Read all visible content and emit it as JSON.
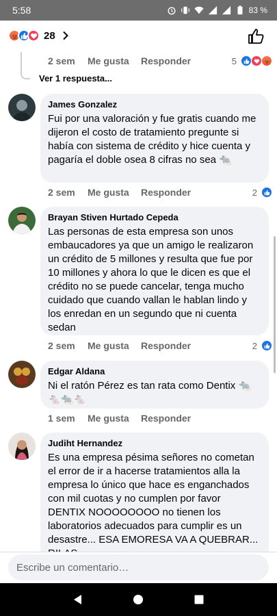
{
  "status_bar": {
    "time": "5:58",
    "battery": "83 %"
  },
  "header": {
    "reaction_count": "28"
  },
  "previous_comment": {
    "time": "2 sem",
    "like_label": "Me gusta",
    "reply_label": "Responder",
    "reaction_count": "5",
    "view_replies": "Ver 1 respuesta..."
  },
  "comments": [
    {
      "author": "James Gonzalez",
      "text": "Fui por una valoración y fue gratis cuando me dijeron el costo de tratamiento pregunte si había con sistema de crédito y hice cuenta y pagaría el doble osea 8 cifras no sea 🐀",
      "time": "2 sem",
      "like_label": "Me gusta",
      "reply_label": "Responder",
      "reaction_count": "2"
    },
    {
      "author": "Brayan Stiven Hurtado Cepeda",
      "text": "Las personas de esta empresa son unos embaucadores ya que un amigo le realizaron un crédito de 5 millones y resulta que fue por 10 millones y ahora lo que le dicen es que el crédito no se puede cancelar, tenga mucho cuidado que cuando vallan le hablan lindo y los enredan  en un segundo que ni cuenta sedan",
      "time": "2 sem",
      "like_label": "Me gusta",
      "reply_label": "Responder",
      "reaction_count": "2"
    },
    {
      "author": "Edgar Aldana",
      "text": "Ni el ratón Pérez es tan rata como Dentix 🐀 🐁🐀🐁",
      "time": "1 sem",
      "like_label": "Me gusta",
      "reply_label": "Responder"
    },
    {
      "author": "Judiht Hernandez",
      "text": "Es una empresa pésima señores no cometan el error de ir a hacerse tratamientos alla la empresa lo único que hace es enganchados con mil cuotas y no cumplen  por favor DENTIX NOOOOOOOO no tienen los laboratorios adecuados para cumplir es un desastre... ESA EMORESA VA A QUEBRAR... RILAS"
    }
  ],
  "composer": {
    "placeholder": "Escribe un comentario…"
  },
  "colors": {
    "like_blue": "#1b74e4",
    "love_red": "#f33e58",
    "angry_orange": "#e8542c",
    "bubble_bg": "#f0f2f5",
    "meta_gray": "#65676b"
  }
}
